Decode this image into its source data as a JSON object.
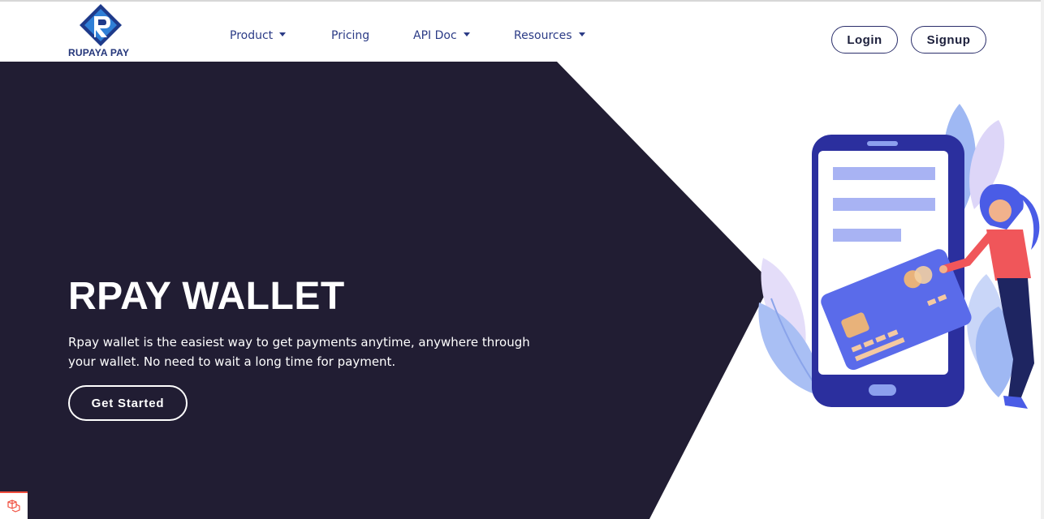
{
  "brand": {
    "name": "RUPAYA PAY",
    "color": "#23357a"
  },
  "nav": {
    "items": [
      {
        "label": "Product",
        "has_dropdown": true
      },
      {
        "label": "Pricing",
        "has_dropdown": false
      },
      {
        "label": "API Doc",
        "has_dropdown": true
      },
      {
        "label": "Resources",
        "has_dropdown": true
      }
    ],
    "login_label": "Login",
    "signup_label": "Signup"
  },
  "hero": {
    "title": "RPAY WALLET",
    "description": "Rpay wallet is the easiest way to get payments anytime, anywhere through your wallet. No need to wait a long time for payment.",
    "cta_label": "Get Started",
    "background_color": "#211d33"
  },
  "illustration": {
    "phone_color": "#2b2f9e",
    "card_color": "#5a6bea",
    "accent_color": "#f0565a"
  },
  "icons": {
    "corner": "laravel-icon"
  }
}
